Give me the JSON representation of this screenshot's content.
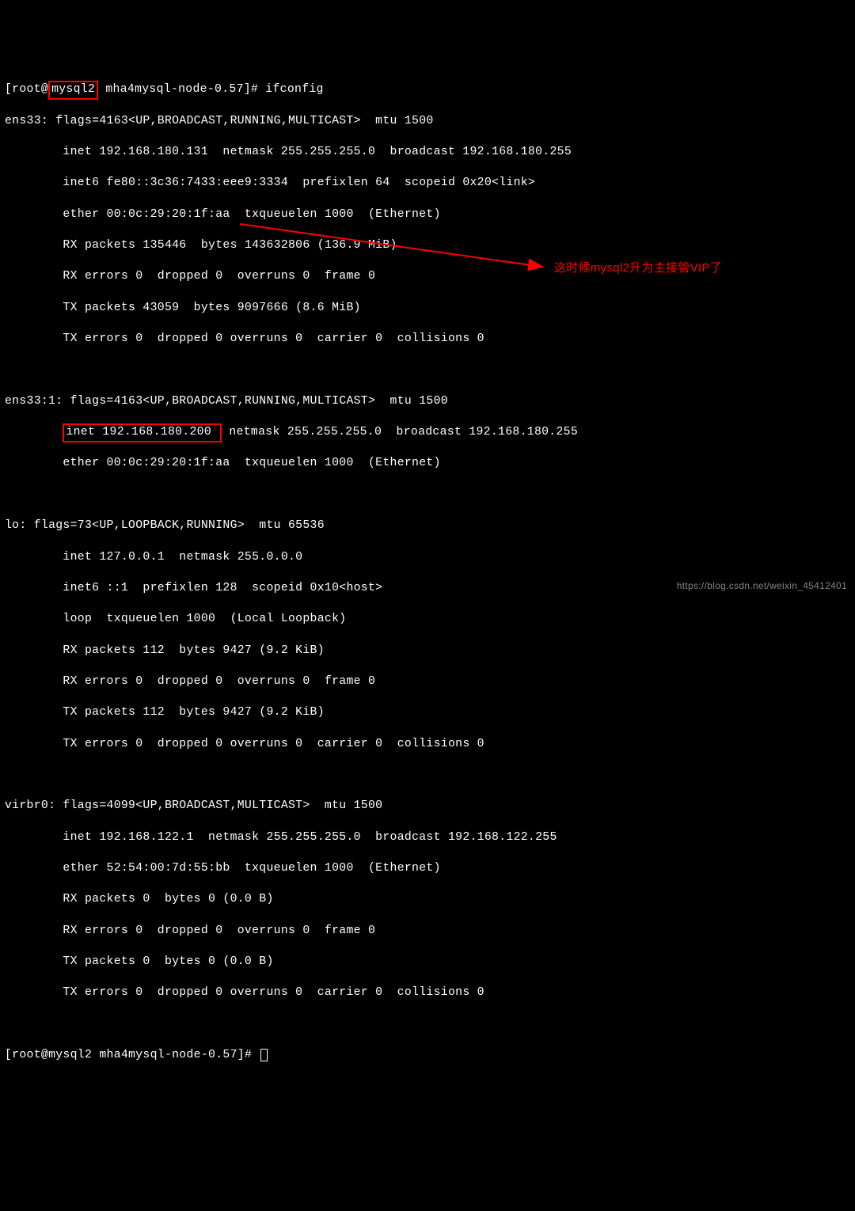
{
  "prompt1": {
    "prefix": "[root@",
    "host": "mysql2",
    "path": " mha4mysql-node-0.57]# ",
    "cmd": "ifconfig"
  },
  "ens33": {
    "l1": "ens33: flags=4163<UP,BROADCAST,RUNNING,MULTICAST>  mtu 1500",
    "l2": "        inet 192.168.180.131  netmask 255.255.255.0  broadcast 192.168.180.255",
    "l3": "        inet6 fe80::3c36:7433:eee9:3334  prefixlen 64  scopeid 0x20<link>",
    "l4": "        ether 00:0c:29:20:1f:aa  txqueuelen 1000  (Ethernet)",
    "l5": "        RX packets 135446  bytes 143632806 (136.9 MiB)",
    "l6": "        RX errors 0  dropped 0  overruns 0  frame 0",
    "l7": "        TX packets 43059  bytes 9097666 (8.6 MiB)",
    "l8": "        TX errors 0  dropped 0 overruns 0  carrier 0  collisions 0"
  },
  "ens33_1": {
    "l1": "ens33:1: flags=4163<UP,BROADCAST,RUNNING,MULTICAST>  mtu 1500",
    "l2_pre": "        ",
    "l2_box": "inet 192.168.180.200 ",
    "l2_post": " netmask 255.255.255.0  broadcast 192.168.180.255",
    "l3": "        ether 00:0c:29:20:1f:aa  txqueuelen 1000  (Ethernet)"
  },
  "lo": {
    "l1": "lo: flags=73<UP,LOOPBACK,RUNNING>  mtu 65536",
    "l2": "        inet 127.0.0.1  netmask 255.0.0.0",
    "l3": "        inet6 ::1  prefixlen 128  scopeid 0x10<host>",
    "l4": "        loop  txqueuelen 1000  (Local Loopback)",
    "l5": "        RX packets 112  bytes 9427 (9.2 KiB)",
    "l6": "        RX errors 0  dropped 0  overruns 0  frame 0",
    "l7": "        TX packets 112  bytes 9427 (9.2 KiB)",
    "l8": "        TX errors 0  dropped 0 overruns 0  carrier 0  collisions 0"
  },
  "virbr0": {
    "l1": "virbr0: flags=4099<UP,BROADCAST,MULTICAST>  mtu 1500",
    "l2": "        inet 192.168.122.1  netmask 255.255.255.0  broadcast 192.168.122.255",
    "l3": "        ether 52:54:00:7d:55:bb  txqueuelen 1000  (Ethernet)",
    "l4": "        RX packets 0  bytes 0 (0.0 B)",
    "l5": "        RX errors 0  dropped 0  overruns 0  frame 0",
    "l6": "        TX packets 0  bytes 0 (0.0 B)",
    "l7": "        TX errors 0  dropped 0 overruns 0  carrier 0  collisions 0"
  },
  "prompt2": "[root@mysql2 mha4mysql-node-0.57]# ",
  "annotation_text": "这时候mysql2升为主接管VIP了",
  "watermark_text": "https://blog.csdn.net/weixin_45412401"
}
